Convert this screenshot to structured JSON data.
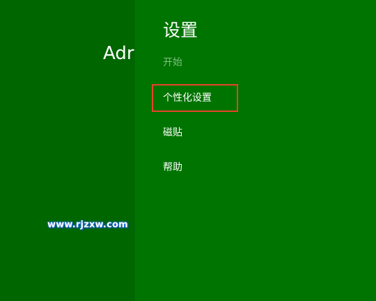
{
  "start_screen": {
    "user_name": "Adr"
  },
  "watermark": "www.rjzxw.com",
  "settings_pane": {
    "title": "设置",
    "items": [
      {
        "label": "开始",
        "enabled": false
      },
      {
        "label": "个性化设置",
        "enabled": true,
        "highlighted": true
      },
      {
        "label": "磁贴",
        "enabled": true
      },
      {
        "label": "帮助",
        "enabled": true
      }
    ]
  },
  "colors": {
    "start_background": "#006600",
    "pane_background": "#007400",
    "highlight_border": "#e8432b",
    "disabled_text": "#7fbf7f"
  }
}
